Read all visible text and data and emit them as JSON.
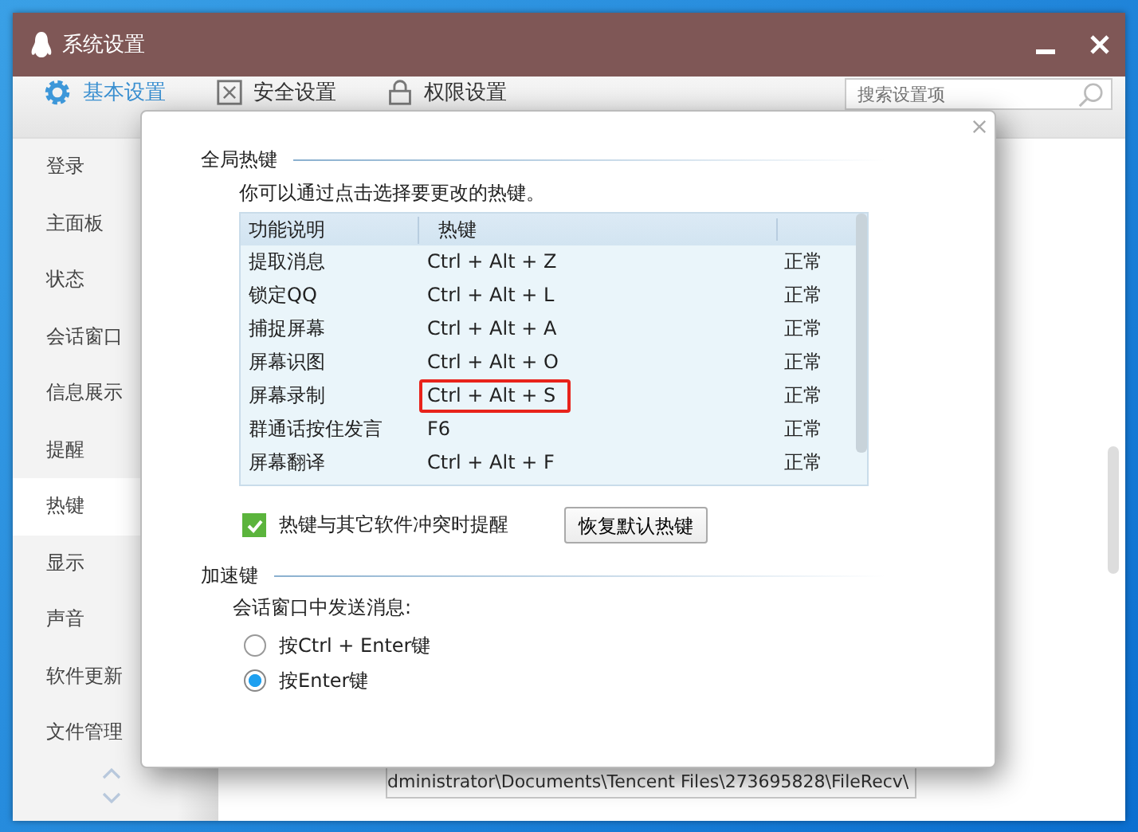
{
  "window": {
    "title": "系统设置"
  },
  "tabs": [
    {
      "label": "基本设置",
      "selected": true
    },
    {
      "label": "安全设置",
      "selected": false
    },
    {
      "label": "权限设置",
      "selected": false
    }
  ],
  "search": {
    "placeholder": "搜索设置项"
  },
  "sidebar": {
    "items": [
      {
        "label": "登录",
        "selected": false
      },
      {
        "label": "主面板",
        "selected": false
      },
      {
        "label": "状态",
        "selected": false
      },
      {
        "label": "会话窗口",
        "selected": false
      },
      {
        "label": "信息展示",
        "selected": false
      },
      {
        "label": "提醒",
        "selected": false
      },
      {
        "label": "热键",
        "selected": true
      },
      {
        "label": "显示",
        "selected": false
      },
      {
        "label": "声音",
        "selected": false
      },
      {
        "label": "软件更新",
        "selected": false
      },
      {
        "label": "文件管理",
        "selected": false
      }
    ]
  },
  "background_content": {
    "path_field": "dministrator\\Documents\\Tencent Files\\273695828\\FileRecv\\"
  },
  "dialog": {
    "global_hotkeys": {
      "heading": "全局热键",
      "hint": "你可以通过点击选择要更改的热键。",
      "table": {
        "columns": [
          "功能说明",
          "热键"
        ],
        "rows": [
          {
            "function": "提取消息",
            "hotkey": "Ctrl + Alt + Z",
            "status": "正常",
            "highlighted": false
          },
          {
            "function": "锁定QQ",
            "hotkey": "Ctrl + Alt + L",
            "status": "正常",
            "highlighted": false
          },
          {
            "function": "捕捉屏幕",
            "hotkey": "Ctrl + Alt + A",
            "status": "正常",
            "highlighted": false
          },
          {
            "function": "屏幕识图",
            "hotkey": "Ctrl + Alt + O",
            "status": "正常",
            "highlighted": false
          },
          {
            "function": "屏幕录制",
            "hotkey": "Ctrl + Alt + S",
            "status": "正常",
            "highlighted": true
          },
          {
            "function": "群通话按住发言",
            "hotkey": "F6",
            "status": "正常",
            "highlighted": false
          },
          {
            "function": "屏幕翻译",
            "hotkey": "Ctrl + Alt + F",
            "status": "正常",
            "highlighted": false
          }
        ]
      },
      "conflict_alert": {
        "label": "热键与其它软件冲突时提醒",
        "checked": true
      },
      "restore_button": "恢复默认热键"
    },
    "accelerators": {
      "heading": "加速键",
      "prompt": "会话窗口中发送消息:",
      "options": [
        {
          "label": "按Ctrl + Enter键",
          "selected": false
        },
        {
          "label": "按Enter键",
          "selected": true
        }
      ]
    }
  }
}
